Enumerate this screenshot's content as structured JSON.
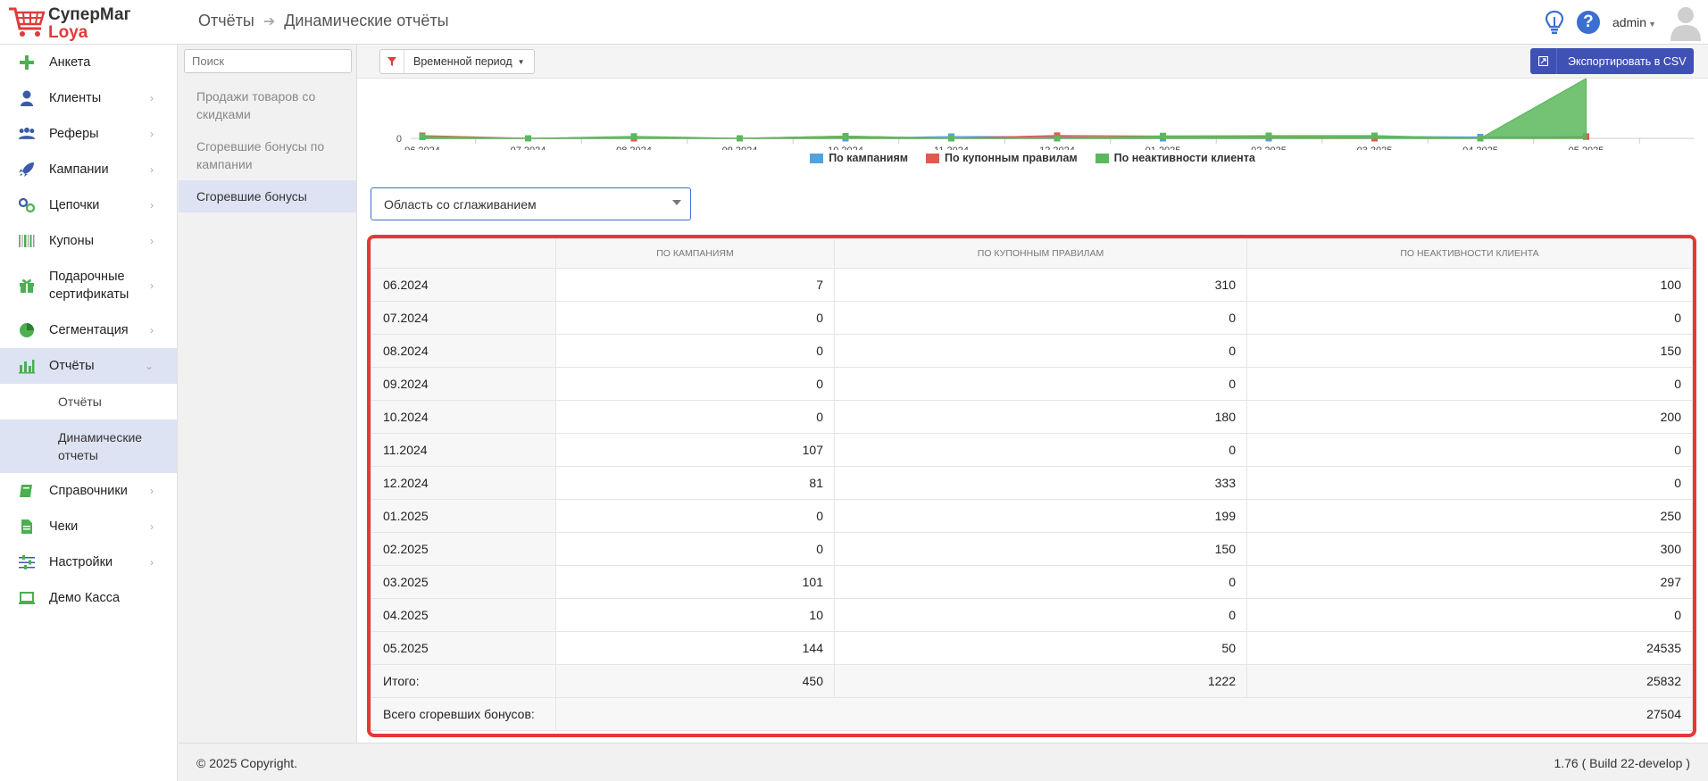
{
  "app": {
    "name_line1": "СуперМаг",
    "name_line2": "Loya"
  },
  "breadcrumb": {
    "parent": "Отчёты",
    "current": "Динамические отчёты"
  },
  "user": {
    "name": "admin"
  },
  "sidebar": {
    "items": [
      {
        "label": "Анкета",
        "icon": "plus-icon"
      },
      {
        "label": "Клиенты",
        "icon": "person-icon"
      },
      {
        "label": "Реферы",
        "icon": "people-icon"
      },
      {
        "label": "Кампании",
        "icon": "rocket-icon"
      },
      {
        "label": "Цепочки",
        "icon": "chain-icon"
      },
      {
        "label": "Купоны",
        "icon": "barcode-icon"
      },
      {
        "label": "Подарочные сертификаты",
        "icon": "gift-icon"
      },
      {
        "label": "Сегментация",
        "icon": "pie-icon"
      },
      {
        "label": "Отчёты",
        "icon": "bar-chart-icon"
      },
      {
        "label": "Справочники",
        "icon": "book-icon"
      },
      {
        "label": "Чеки",
        "icon": "receipt-icon"
      },
      {
        "label": "Настройки",
        "icon": "sliders-icon"
      },
      {
        "label": "Демо Касса",
        "icon": "laptop-icon"
      }
    ],
    "subitems": [
      {
        "label": "Отчёты"
      },
      {
        "label": "Динамические отчеты"
      }
    ]
  },
  "reports": {
    "search_placeholder": "Поиск",
    "items": [
      {
        "label": "Продажи товаров со скидками"
      },
      {
        "label": "Сгоревшие бонусы по кампании"
      },
      {
        "label": "Сгоревшие бонусы"
      }
    ]
  },
  "toolbar": {
    "filter_label": "Временной период",
    "export_label": "Экспортировать в CSV"
  },
  "chart_data": {
    "type": "area",
    "x": [
      "06.2024",
      "07.2024",
      "08.2024",
      "09.2024",
      "10.2024",
      "11.2024",
      "12.2024",
      "01.2025",
      "02.2025",
      "03.2025",
      "04.2025",
      "05.2025"
    ],
    "y_tick_visible": "0",
    "series": [
      {
        "name": "По кампаниям",
        "color": "#4fa3e0",
        "values": [
          7,
          0,
          0,
          0,
          0,
          107,
          81,
          0,
          0,
          101,
          10,
          144
        ]
      },
      {
        "name": "По купонным правилам",
        "color": "#e05a4f",
        "values": [
          310,
          0,
          0,
          0,
          180,
          0,
          333,
          199,
          150,
          0,
          0,
          50
        ]
      },
      {
        "name": "По неактивности клиента",
        "color": "#5cb85c",
        "values": [
          100,
          0,
          150,
          0,
          200,
          0,
          0,
          250,
          300,
          297,
          0,
          24535
        ]
      }
    ]
  },
  "chart_type_select": {
    "value": "Область со сглаживанием"
  },
  "table": {
    "headers": [
      "",
      "ПО КАМПАНИЯМ",
      "ПО КУПОННЫМ ПРАВИЛАМ",
      "ПО НЕАКТИВНОСТИ КЛИЕНТА"
    ],
    "rows": [
      {
        "period": "06.2024",
        "campaigns": "7",
        "coupons": "310",
        "inactivity": "100"
      },
      {
        "period": "07.2024",
        "campaigns": "0",
        "coupons": "0",
        "inactivity": "0"
      },
      {
        "period": "08.2024",
        "campaigns": "0",
        "coupons": "0",
        "inactivity": "150"
      },
      {
        "period": "09.2024",
        "campaigns": "0",
        "coupons": "0",
        "inactivity": "0"
      },
      {
        "period": "10.2024",
        "campaigns": "0",
        "coupons": "180",
        "inactivity": "200"
      },
      {
        "period": "11.2024",
        "campaigns": "107",
        "coupons": "0",
        "inactivity": "0"
      },
      {
        "period": "12.2024",
        "campaigns": "81",
        "coupons": "333",
        "inactivity": "0"
      },
      {
        "period": "01.2025",
        "campaigns": "0",
        "coupons": "199",
        "inactivity": "250"
      },
      {
        "period": "02.2025",
        "campaigns": "0",
        "coupons": "150",
        "inactivity": "300"
      },
      {
        "period": "03.2025",
        "campaigns": "101",
        "coupons": "0",
        "inactivity": "297"
      },
      {
        "period": "04.2025",
        "campaigns": "10",
        "coupons": "0",
        "inactivity": "0"
      },
      {
        "period": "05.2025",
        "campaigns": "144",
        "coupons": "50",
        "inactivity": "24535"
      }
    ],
    "total": {
      "label": "Итого:",
      "campaigns": "450",
      "coupons": "1222",
      "inactivity": "25832"
    },
    "grand_total": {
      "label": "Всего сгоревших бонусов:",
      "value": "27504"
    }
  },
  "footer": {
    "copyright": "© 2025 Copyright.",
    "version": "1.76 ( Build 22-develop )"
  }
}
